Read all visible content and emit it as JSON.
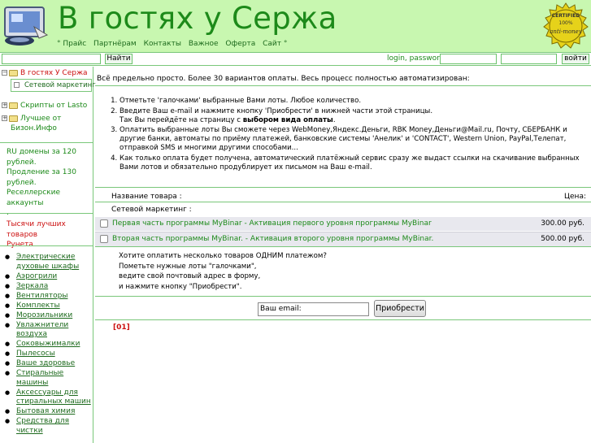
{
  "header": {
    "title": "В гостях у Сержа",
    "nav": [
      {
        "label": "Прайс"
      },
      {
        "label": "Партнёрам"
      },
      {
        "label": "Контакты"
      },
      {
        "label": "Важное"
      },
      {
        "label": "Оферта"
      },
      {
        "label": "Сайт"
      }
    ],
    "seal_text": [
      "CERTIFIED",
      "100%",
      "anti-money"
    ]
  },
  "bar": {
    "search_button": "Найти",
    "login_label": "login, password:",
    "login_button": "войти"
  },
  "sidebar": {
    "tree": [
      {
        "label": "В гостях У Сержа",
        "toggle": "⊟"
      },
      {
        "label": "Сетевой маркетинг"
      },
      {
        "label": "Скрипты от Lasto",
        "toggle": "⊞"
      },
      {
        "label_lines": [
          "Лучшее от",
          "Бизон.Инфо"
        ],
        "toggle": "⊞"
      }
    ],
    "promo_lines": [
      "RU домены за 120",
      "рублей.",
      "Продление за 130",
      "рублей.",
      "Реселлерские аккаунты",
      "."
    ],
    "top_lines": [
      "Тысячи лучших товаров",
      "Рунета"
    ],
    "categories": [
      "Электрические духовые шкафы",
      "Аэрогрили",
      "Зеркала",
      "Вентиляторы",
      "Комплекты",
      "Морозильники",
      "Увлажнители воздуха",
      "Соковыжималки",
      "Пылесосы",
      "Ваше здоровье",
      "Стиральные машины",
      "Аксессуары для стиральных машин",
      "Бытовая химия",
      "Средства для чистки"
    ]
  },
  "main": {
    "intro": "Всё предельно просто. Более 30 вариантов оплаты. Весь процесс полностью автоматизирован:",
    "steps": {
      "s1": "Отметьте 'галочками' выбранные Вами лоты. Любое количество.",
      "s2a": "Введите Ваш e-mail и нажмите кнопку 'Приобрести' в нижней части этой страницы.",
      "s2b": "Так Вы перейдёте на страницу с ",
      "s2bold": "выбором вида оплаты",
      "s2end": ".",
      "s3": "Оплатить выбранные лоты Вы сможете через WebMoney,Яндекс.Деньги, RBK Money,Деньги@Mail.ru, Почту, СБЕРБАНК и другие банки, автоматы по приёму платежей, банковские системы 'Анелик' и 'CONTACT', Western Union, PayPal,Телепат, отправкой SMS и многими другими способами...",
      "s4": "Как только оплата будет получена, автоматический платёжный сервис сразу же выдаст ссылки на скачивание выбранных Вами лотов и обязательно продублирует их письмом на Ваш e-mail."
    },
    "table": {
      "name_header": "Название товара :",
      "price_header": "Цена:",
      "group": "Сетевой маркетинг :",
      "rows": [
        {
          "name": "Первая часть программы MyBinar - Активация первого уровня программы MyBinar",
          "price": "300.00 руб."
        },
        {
          "name": "Вторая часть программы MyBinar. - Активация второго уровня программы MyBinar.",
          "price": "500.00 руб."
        }
      ]
    },
    "hint_lines": [
      "Хотите оплатить несколько товаров ОДНИМ платежом?",
      "Пометьте нужные лоты \"галочками\",",
      "ведите свой почтовый адрес в форму,",
      "и нажмите кнопку \"Приобрести\"."
    ],
    "email_value": "Ваш email:",
    "buy_button": "Приобрести",
    "code": "[01]"
  },
  "colors": {
    "header_bg": "#c8f7b0",
    "title_green": "#1d8a1a",
    "accent_red": "#cc1111",
    "border_green": "#7ac77a",
    "row_bg": "#e8e8ee"
  }
}
